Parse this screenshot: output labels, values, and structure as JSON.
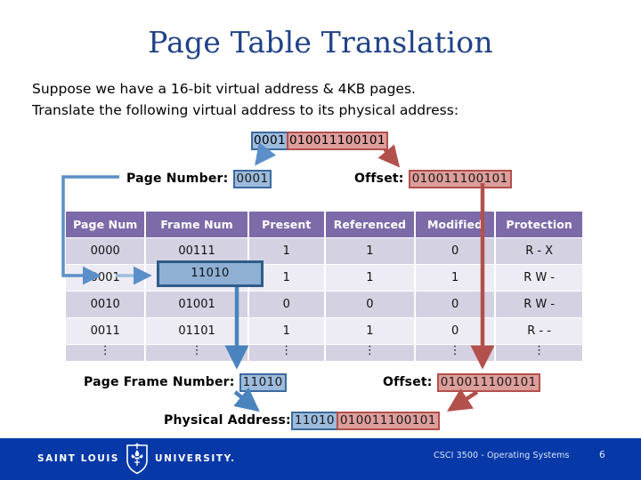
{
  "slide": {
    "title": "Page Table Translation",
    "intro_line_1": "Suppose we have a 16-bit virtual address & 4KB pages.",
    "intro_line_2": "Translate the following virtual address to its physical address:"
  },
  "virtual_address": {
    "page_number_bits": "0001",
    "offset_bits": "010011100101",
    "full": "0001010011100101"
  },
  "labels": {
    "page_number": "Page Number:",
    "page_number_value": "0001",
    "offset": "Offset:",
    "offset_value": "010011100101",
    "page_frame_number": "Page Frame Number:",
    "page_frame_number_value": "11010",
    "offset_bottom": "Offset:",
    "offset_bottom_value": "010011100101",
    "physical_address": "Physical Address:",
    "physical_address_frame": "11010",
    "physical_address_offset": "010011100101"
  },
  "table": {
    "headers": [
      "Page Num",
      "Frame Num",
      "Present",
      "Referenced",
      "Modified",
      "Protection"
    ],
    "rows": [
      {
        "page_num": "0000",
        "frame_num": "00111",
        "present": "1",
        "referenced": "1",
        "modified": "0",
        "protection": "R - X"
      },
      {
        "page_num": "0001",
        "frame_num": "11010",
        "present": "1",
        "referenced": "1",
        "modified": "1",
        "protection": "R W -"
      },
      {
        "page_num": "0010",
        "frame_num": "01001",
        "present": "0",
        "referenced": "0",
        "modified": "0",
        "protection": "R W -"
      },
      {
        "page_num": "0011",
        "frame_num": "01101",
        "present": "1",
        "referenced": "1",
        "modified": "0",
        "protection": "R - -"
      }
    ],
    "continuation": "⋮",
    "highlighted_row_index": 1,
    "highlighted_frame_value": "11010"
  },
  "footer": {
    "university": [
      "SAINT LOUIS",
      "UNIVERSITY."
    ],
    "course": "CSCI 3500 - Operating Systems",
    "page_number": "6"
  },
  "colors": {
    "title": "#1F4286",
    "header_purple": "#7D6AA8",
    "row_dark": "#D4D2E2",
    "row_light": "#EDEBF3",
    "blue_accent": "#3C6A9E",
    "blue_fill": "#9DBBDC",
    "red_accent": "#B2504C",
    "red_fill": "#DD9E9B",
    "footer_blue": "#0638A7"
  }
}
